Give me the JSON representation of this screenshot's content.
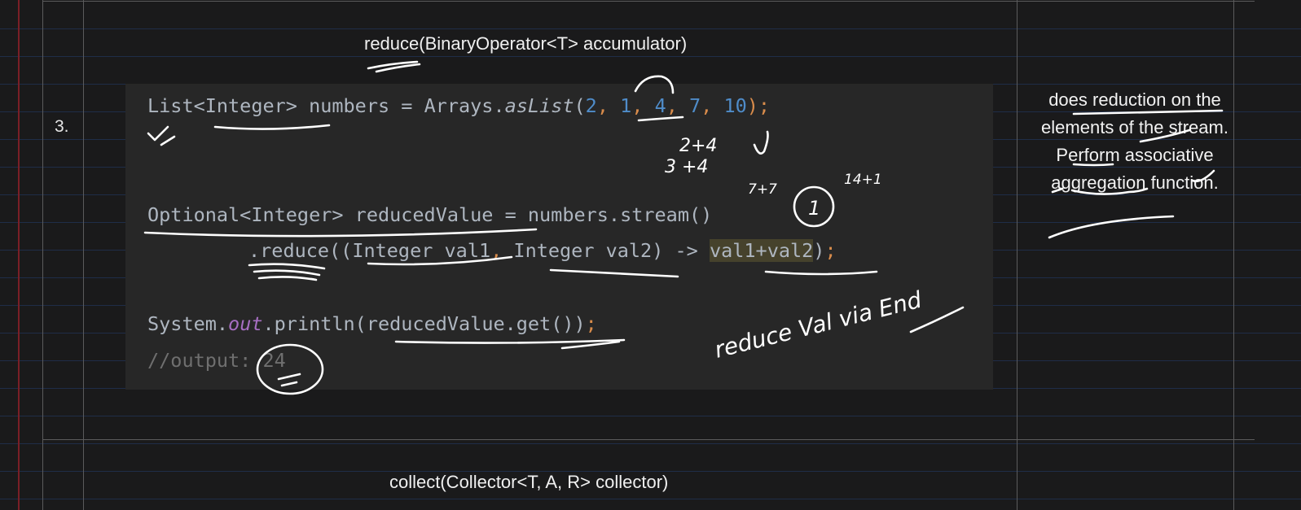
{
  "table": {
    "row_number": "3.",
    "method_signature": "reduce(BinaryOperator<T> accumulator)",
    "description": "does reduction on the elements of the stream. Perform associative aggregation function.",
    "next_method_signature": "collect(Collector<T, A, R> collector)"
  },
  "code": {
    "line1": {
      "type": "List<Integer>",
      "var": " numbers = Arrays.",
      "method": "asList",
      "open": "(",
      "n1": "2",
      "sep1": ", ",
      "n2": "1",
      "sep2": ", ",
      "n3": "4",
      "sep3": ", ",
      "n4": "7",
      "sep4": ", ",
      "n5": "10",
      "close": ");"
    },
    "line2": {
      "text": "Optional<Integer> reducedValue = numbers.stream()"
    },
    "line3": {
      "prefix": ".reduce((Integer val1",
      "comma": ",",
      "middle": " Integer val2) -> ",
      "highlight": "val1+val2",
      "paren": ")",
      "semi": ";"
    },
    "line4": {
      "start": "System.",
      "out": "out",
      "mid": ".println(reducedValue.get())",
      "semi": ";"
    },
    "line5": {
      "comment": "//output: 24"
    }
  },
  "handwriting": {
    "sum_note_1": "2+4",
    "sum_note_2": "3 +4",
    "note_7": "7+7",
    "note_14": "14+1",
    "circled": "1",
    "side_note": "reduce Val via End"
  },
  "colors": {
    "background": "#1a1a1b",
    "ruled_line": "#1f2d48",
    "margin_line": "#7a1f26",
    "code_panel": "#272727",
    "keyword": "#d98c4b",
    "number": "#4f8cc9",
    "field": "#a76fc2"
  }
}
